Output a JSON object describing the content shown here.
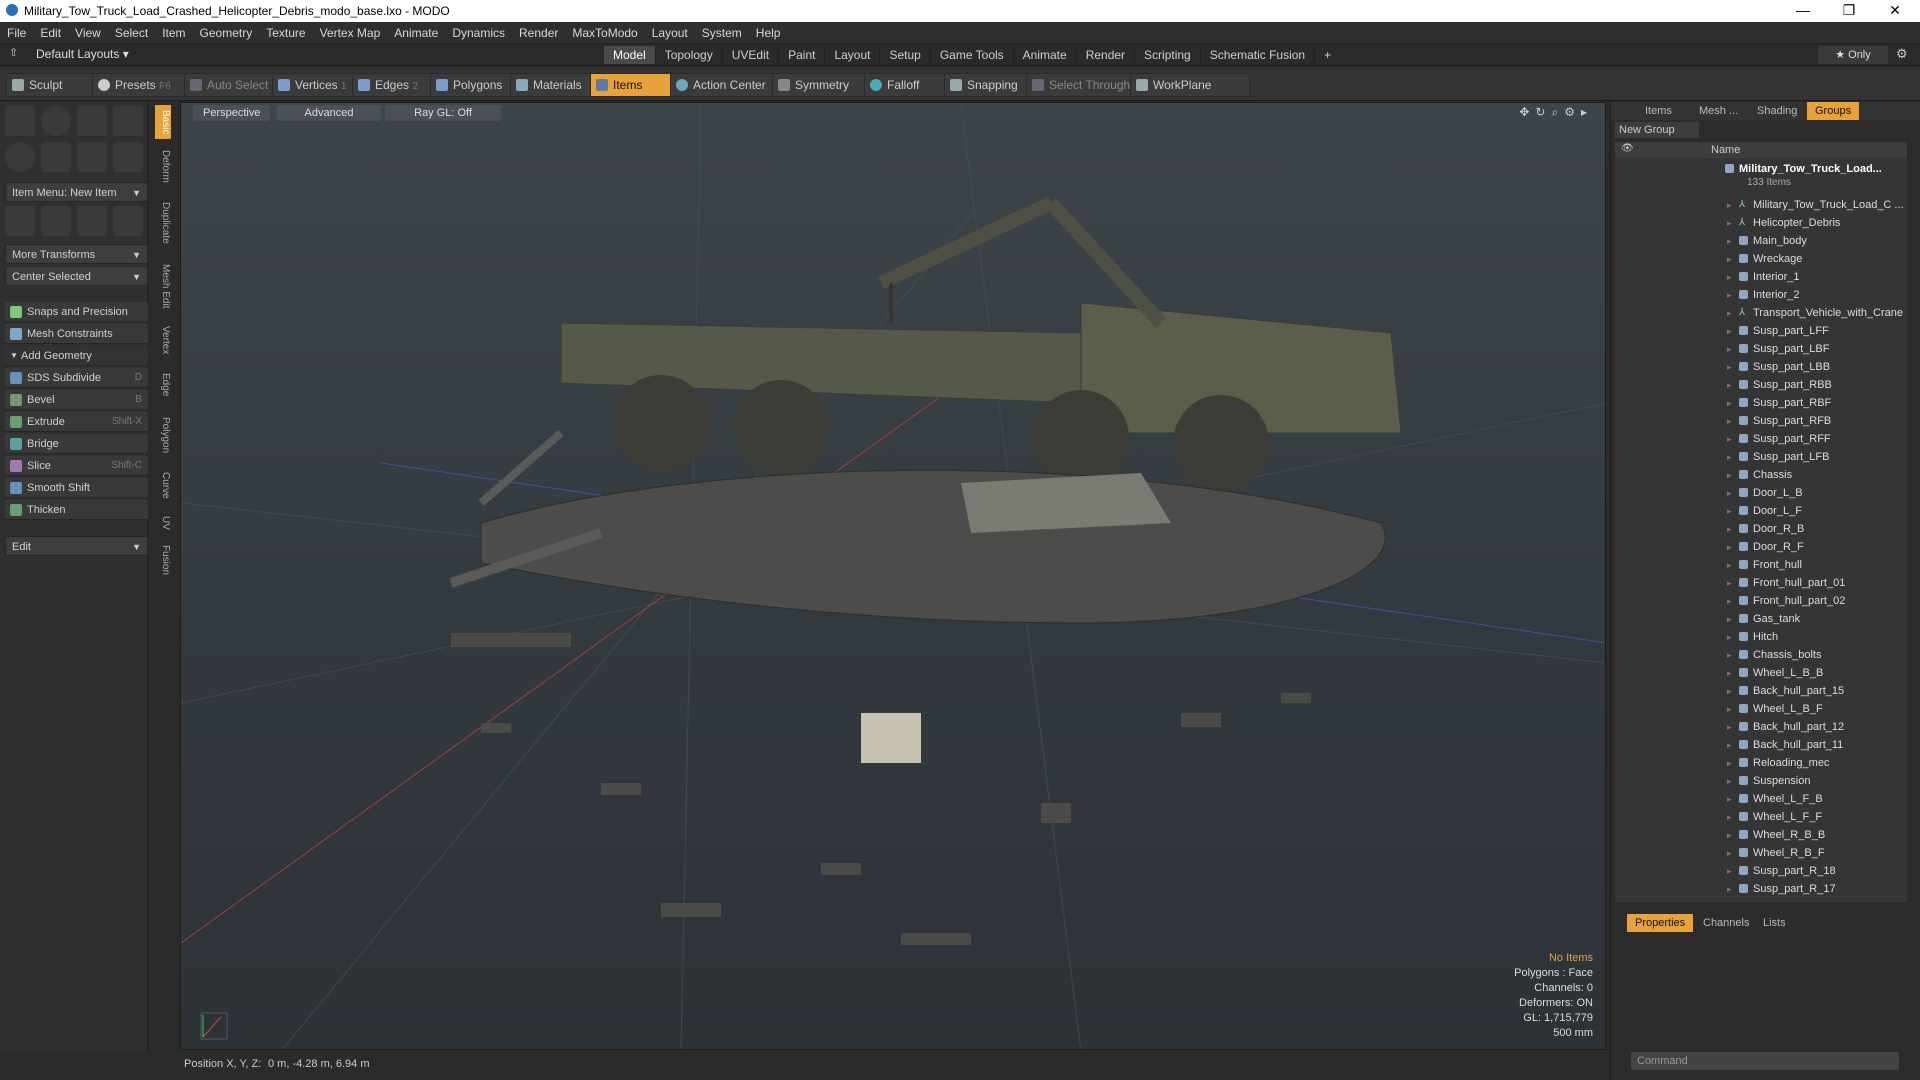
{
  "window": {
    "title": "Military_Tow_Truck_Load_Crashed_Helicopter_Debris_modo_base.lxo - MODO",
    "min": "—",
    "max": "❐",
    "close": "✕"
  },
  "menu": [
    "File",
    "Edit",
    "View",
    "Select",
    "Item",
    "Geometry",
    "Texture",
    "Vertex Map",
    "Animate",
    "Dynamics",
    "Render",
    "MaxToModo",
    "Layout",
    "System",
    "Help"
  ],
  "layoutbar": {
    "default_layouts": "Default Layouts ▾",
    "tabs": [
      "Model",
      "Topology",
      "UVEdit",
      "Paint",
      "Layout",
      "Setup",
      "Game Tools",
      "Animate",
      "Render",
      "Scripting",
      "Schematic Fusion"
    ],
    "active_tab": "Model",
    "add": "+",
    "only": "★ Only"
  },
  "toolbar": {
    "sculpt": "Sculpt",
    "presets": "Presets",
    "presets_key": "F6",
    "auto_select": "Auto Select",
    "vertices": "Vertices",
    "vertices_n": "1",
    "edges": "Edges",
    "edges_n": "2",
    "polygons": "Polygons",
    "materials": "Materials",
    "items": "Items",
    "action_center": "Action Center",
    "symmetry": "Symmetry",
    "falloff": "Falloff",
    "snapping": "Snapping",
    "select_through": "Select Through",
    "workplane": "WorkPlane"
  },
  "leftpanel": {
    "item_menu": "Item Menu: New Item",
    "more_transforms": "More Transforms",
    "center_selected": "Center Selected",
    "snaps": "Snaps and Precision",
    "mesh_constraints": "Mesh Constraints",
    "add_geometry": "Add Geometry",
    "tools": [
      {
        "label": "SDS Subdivide",
        "key": "D",
        "color": "#6a8fbf"
      },
      {
        "label": "Bevel",
        "key": "B",
        "color": "#6aa06a"
      },
      {
        "label": "Extrude",
        "key": "Shift-X",
        "color": "#6aa06a"
      },
      {
        "label": "Bridge",
        "key": "",
        "color": "#5aa0a0"
      },
      {
        "label": "Slice",
        "key": "Shift-C",
        "color": "#a07ab0"
      },
      {
        "label": "Smooth Shift",
        "key": "",
        "color": "#6a8fbf"
      },
      {
        "label": "Thicken",
        "key": "",
        "color": "#6aa06a"
      }
    ],
    "edit": "Edit",
    "vtabs": [
      "Basic",
      "Deform",
      "Duplicate",
      "Mesh Edit",
      "Vertex",
      "Edge",
      "Polygon",
      "Curve",
      "UV",
      "Fusion"
    ]
  },
  "viewport": {
    "perspective": "Perspective",
    "advanced": "Advanced",
    "raygl": "Ray GL: Off",
    "stats": {
      "no_items": "No Items",
      "polygons": "Polygons : Face",
      "channels": "Channels: 0",
      "deformers": "Deformers: ON",
      "gl": "GL: 1,715,779",
      "scale": "500 mm"
    }
  },
  "statusbar": {
    "position_label": "Position X, Y, Z:",
    "position_value": "0 m, -4.28 m, 6.94 m"
  },
  "rightpanel": {
    "tabs": [
      "Items",
      "Mesh ...",
      "Shading",
      "Groups"
    ],
    "active_tab": "Groups",
    "new_group": "New Group",
    "name_header": "Name",
    "root": "Military_Tow_Truck_Load...",
    "root_count": "133 Items",
    "items": [
      {
        "name": "Military_Tow_Truck_Load_C ...",
        "type": "loc"
      },
      {
        "name": "Helicopter_Debris",
        "type": "loc"
      },
      {
        "name": "Main_body",
        "type": "mesh"
      },
      {
        "name": "Wreckage",
        "type": "mesh"
      },
      {
        "name": "Interior_1",
        "type": "mesh"
      },
      {
        "name": "Interior_2",
        "type": "mesh"
      },
      {
        "name": "Transport_Vehicle_with_Crane",
        "type": "loc"
      },
      {
        "name": "Susp_part_LFF",
        "type": "mesh"
      },
      {
        "name": "Susp_part_LBF",
        "type": "mesh"
      },
      {
        "name": "Susp_part_LBB",
        "type": "mesh"
      },
      {
        "name": "Susp_part_RBB",
        "type": "mesh"
      },
      {
        "name": "Susp_part_RBF",
        "type": "mesh"
      },
      {
        "name": "Susp_part_RFB",
        "type": "mesh"
      },
      {
        "name": "Susp_part_RFF",
        "type": "mesh"
      },
      {
        "name": "Susp_part_LFB",
        "type": "mesh"
      },
      {
        "name": "Chassis",
        "type": "mesh"
      },
      {
        "name": "Door_L_B",
        "type": "mesh"
      },
      {
        "name": "Door_L_F",
        "type": "mesh"
      },
      {
        "name": "Door_R_B",
        "type": "mesh"
      },
      {
        "name": "Door_R_F",
        "type": "mesh"
      },
      {
        "name": "Front_hull",
        "type": "mesh"
      },
      {
        "name": "Front_hull_part_01",
        "type": "mesh"
      },
      {
        "name": "Front_hull_part_02",
        "type": "mesh"
      },
      {
        "name": "Gas_tank",
        "type": "mesh"
      },
      {
        "name": "Hitch",
        "type": "mesh"
      },
      {
        "name": "Chassis_bolts",
        "type": "mesh"
      },
      {
        "name": "Wheel_L_B_B",
        "type": "mesh"
      },
      {
        "name": "Back_hull_part_15",
        "type": "mesh"
      },
      {
        "name": "Wheel_L_B_F",
        "type": "mesh"
      },
      {
        "name": "Back_hull_part_12",
        "type": "mesh"
      },
      {
        "name": "Back_hull_part_11",
        "type": "mesh"
      },
      {
        "name": "Reloading_mec",
        "type": "mesh"
      },
      {
        "name": "Suspension",
        "type": "mesh"
      },
      {
        "name": "Wheel_L_F_B",
        "type": "mesh"
      },
      {
        "name": "Wheel_L_F_F",
        "type": "mesh"
      },
      {
        "name": "Wheel_R_B_B",
        "type": "mesh"
      },
      {
        "name": "Wheel_R_B_F",
        "type": "mesh"
      },
      {
        "name": "Susp_part_R_18",
        "type": "mesh"
      },
      {
        "name": "Susp_part_R_17",
        "type": "mesh"
      }
    ],
    "bottom_tabs": [
      "Properties",
      "Channels",
      "Lists"
    ],
    "bottom_active": "Properties",
    "command_placeholder": "Command"
  }
}
